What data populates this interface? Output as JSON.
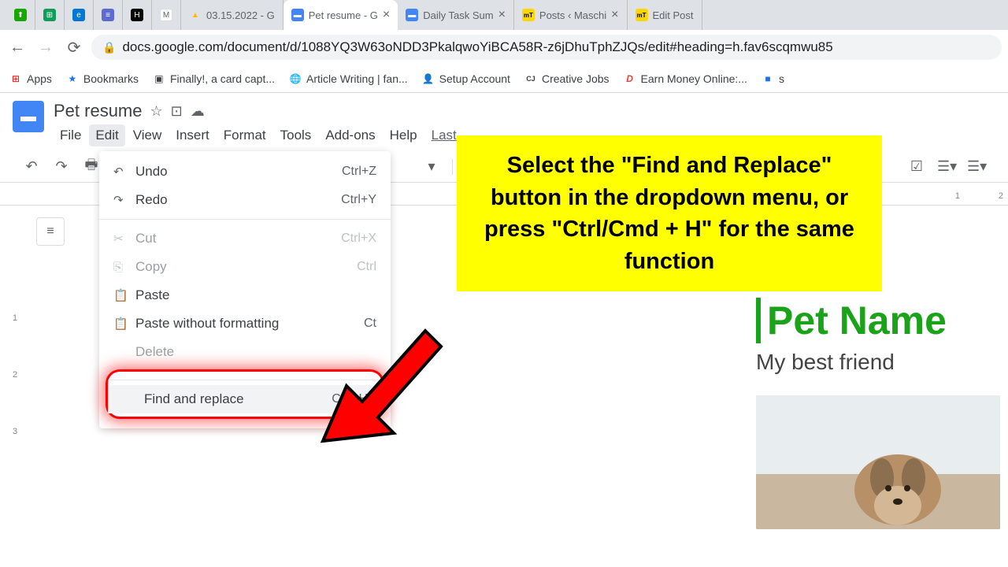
{
  "browser": {
    "tabs": [
      {
        "favicon_bg": "#14a800",
        "favicon_txt": "",
        "label": "",
        "active": false
      },
      {
        "favicon_bg": "#0f9d58",
        "favicon_txt": "⊞",
        "label": "",
        "active": false
      },
      {
        "favicon_bg": "#0078d4",
        "favicon_txt": "e",
        "label": "",
        "active": false
      },
      {
        "favicon_bg": "#5e6ad2",
        "favicon_txt": "≡",
        "label": "",
        "active": false
      },
      {
        "favicon_bg": "#000",
        "favicon_txt": "H",
        "label": "",
        "active": false
      },
      {
        "favicon_bg": "#fff",
        "favicon_txt": "M",
        "label": "",
        "active": false
      },
      {
        "favicon_bg": "#ffba00",
        "favicon_txt": "▲",
        "label": "03.15.2022 - G",
        "active": false
      },
      {
        "favicon_bg": "#4285f4",
        "favicon_txt": "▬",
        "label": "Pet resume - G",
        "active": true
      },
      {
        "favicon_bg": "#4285f4",
        "favicon_txt": "▬",
        "label": "Daily Task Sum",
        "active": false
      },
      {
        "favicon_bg": "#ffd700",
        "favicon_txt": "mT",
        "label": "Posts ‹ Maschi",
        "active": false
      },
      {
        "favicon_bg": "#ffd700",
        "favicon_txt": "mT",
        "label": "Edit Post",
        "active": false
      }
    ],
    "url": "docs.google.com/document/d/1088YQ3W63oNDD3PkalqwoYiBCA58R-z6jDhuTphZJQs/edit#heading=h.fav6scqmwu85",
    "bookmarks": [
      {
        "icon": "⊞",
        "color": "#ff0000",
        "label": "Apps"
      },
      {
        "icon": "★",
        "color": "#1a73e8",
        "label": "Bookmarks"
      },
      {
        "icon": "▣",
        "color": "#5f6368",
        "label": "Finally!, a card capt..."
      },
      {
        "icon": "🌐",
        "color": "#5f6368",
        "label": "Article Writing | fan..."
      },
      {
        "icon": "👤",
        "color": "#ea4335",
        "label": "Setup Account"
      },
      {
        "icon": "CJ",
        "color": "#000",
        "label": "Creative Jobs"
      },
      {
        "icon": "D",
        "color": "#ea4335",
        "label": "Earn Money Online:..."
      },
      {
        "icon": "■",
        "color": "#1a73e8",
        "label": "s"
      }
    ]
  },
  "docs": {
    "title": "Pet resume",
    "menus": [
      "File",
      "Edit",
      "View",
      "Insert",
      "Format",
      "Tools",
      "Add-ons",
      "Help"
    ],
    "last_edit": "Last",
    "edit_menu": {
      "undo": {
        "label": "Undo",
        "shortcut": "Ctrl+Z"
      },
      "redo": {
        "label": "Redo",
        "shortcut": "Ctrl+Y"
      },
      "cut": {
        "label": "Cut",
        "shortcut": "Ctrl+X"
      },
      "copy": {
        "label": "Copy",
        "shortcut": "Ctrl"
      },
      "paste": {
        "label": "Paste"
      },
      "paste_wf": {
        "label": "Paste without formatting",
        "shortcut": "Ct"
      },
      "delete": {
        "label": "Delete"
      },
      "find_replace": {
        "label": "Find and replace",
        "shortcut": "Ctrl+H"
      }
    }
  },
  "callout": {
    "text": "Select the \"Find and Replace\" button in the dropdown menu, or press \"Ctrl/Cmd + H\" for the same function"
  },
  "document": {
    "heading": "Pet Name",
    "subheading": "My best friend"
  },
  "ruler_marks": [
    "1",
    "2"
  ],
  "vruler_marks": [
    "",
    "1",
    "2",
    "3"
  ]
}
